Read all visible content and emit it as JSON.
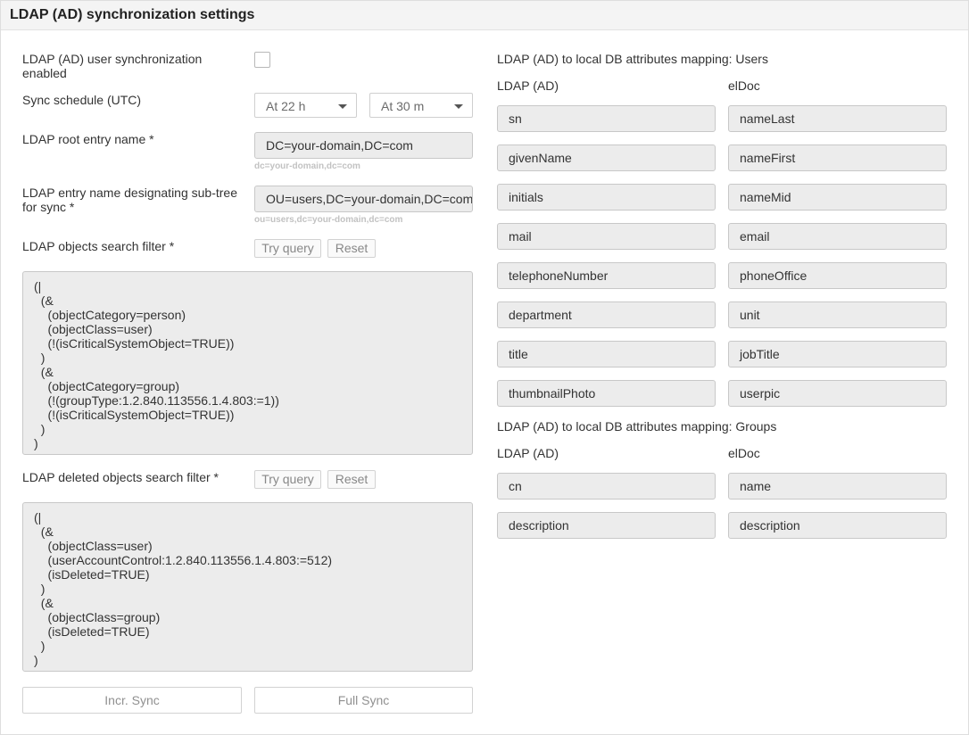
{
  "header": {
    "title": "LDAP (AD) synchronization settings"
  },
  "left": {
    "sync_enabled_label": "LDAP (AD) user synchronization enabled",
    "sync_enabled_checked": false,
    "schedule_label": "Sync schedule (UTC)",
    "schedule_hour": "At 22 h",
    "schedule_minute": "At 30 m",
    "root_label": "LDAP root entry name",
    "root_value": "DC=your-domain,DC=com",
    "root_hint": "dc=your-domain,dc=com",
    "subtree_label": "LDAP entry name designating sub-tree for sync",
    "subtree_value": "OU=users,DC=your-domain,DC=com",
    "subtree_hint": "ou=users,dc=your-domain,dc=com",
    "required_mark": "*",
    "search_filter_label": "LDAP objects search filter",
    "try_query": "Try query",
    "reset": "Reset",
    "search_filter_value": "(|\n  (&\n    (objectCategory=person)\n    (objectClass=user)\n    (!(isCriticalSystemObject=TRUE))\n  )\n  (&\n    (objectCategory=group)\n    (!(groupType:1.2.840.113556.1.4.803:=1))\n    (!(isCriticalSystemObject=TRUE))\n  )\n)",
    "deleted_filter_label": "LDAP deleted objects search filter",
    "deleted_filter_value": "(|\n  (&\n    (objectClass=user)\n    (userAccountControl:1.2.840.113556.1.4.803:=512)\n    (isDeleted=TRUE)\n  )\n  (&\n    (objectClass=group)\n    (isDeleted=TRUE)\n  )\n)",
    "incr_sync": "Incr. Sync",
    "full_sync": "Full Sync"
  },
  "users_mapping": {
    "title": "LDAP (AD) to local DB attributes mapping: Users",
    "col_ldap": "LDAP (AD)",
    "col_local": "elDoc",
    "rows": [
      {
        "ldap": "sn",
        "local": "nameLast"
      },
      {
        "ldap": "givenName",
        "local": "nameFirst"
      },
      {
        "ldap": "initials",
        "local": "nameMid"
      },
      {
        "ldap": "mail",
        "local": "email"
      },
      {
        "ldap": "telephoneNumber",
        "local": "phoneOffice"
      },
      {
        "ldap": "department",
        "local": "unit"
      },
      {
        "ldap": "title",
        "local": "jobTitle"
      },
      {
        "ldap": "thumbnailPhoto",
        "local": "userpic"
      }
    ]
  },
  "groups_mapping": {
    "title": "LDAP (AD) to local DB attributes mapping: Groups",
    "col_ldap": "LDAP (AD)",
    "col_local": "elDoc",
    "rows": [
      {
        "ldap": "cn",
        "local": "name"
      },
      {
        "ldap": "description",
        "local": "description"
      }
    ]
  }
}
